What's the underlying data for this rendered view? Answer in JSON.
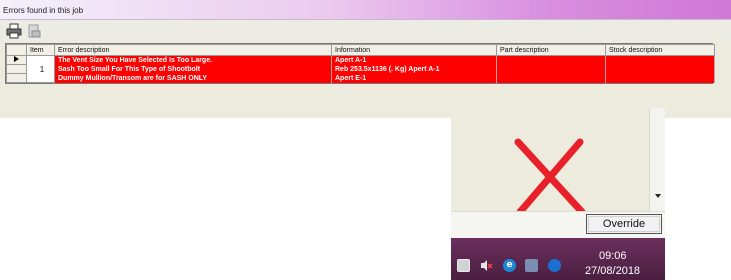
{
  "window": {
    "title": "Errors found in this job"
  },
  "toolbar": {
    "icons": [
      "print-icon",
      "export-icon"
    ]
  },
  "grid": {
    "columns": [
      "Item",
      "Error description",
      "Information",
      "Part description",
      "Stock description"
    ],
    "item": "1",
    "rows": [
      {
        "error": "The Vent Size You Have Selected Is Too Large.",
        "info": "Apert A-1",
        "part": "",
        "stock": ""
      },
      {
        "error": "Sash Too Small For This Type of Shootbolt",
        "info": "Reb 253.5x1136 (. Kg) Apert A-1",
        "part": "",
        "stock": ""
      },
      {
        "error": "Dummy Mullion/Transom are for SASH ONLY",
        "info": "Apert E-1",
        "part": "",
        "stock": ""
      }
    ],
    "error_color": "#ff0000"
  },
  "override": {
    "label": "Override"
  },
  "annotation": {
    "icon": "red-x-mark",
    "color": "#e8202a"
  },
  "taskbar": {
    "time": "09:06",
    "date": "27/08/2018",
    "icons": [
      "network-icon",
      "volume-muted-icon",
      "edge-icon",
      "app-icon",
      "chrome-icon"
    ]
  }
}
